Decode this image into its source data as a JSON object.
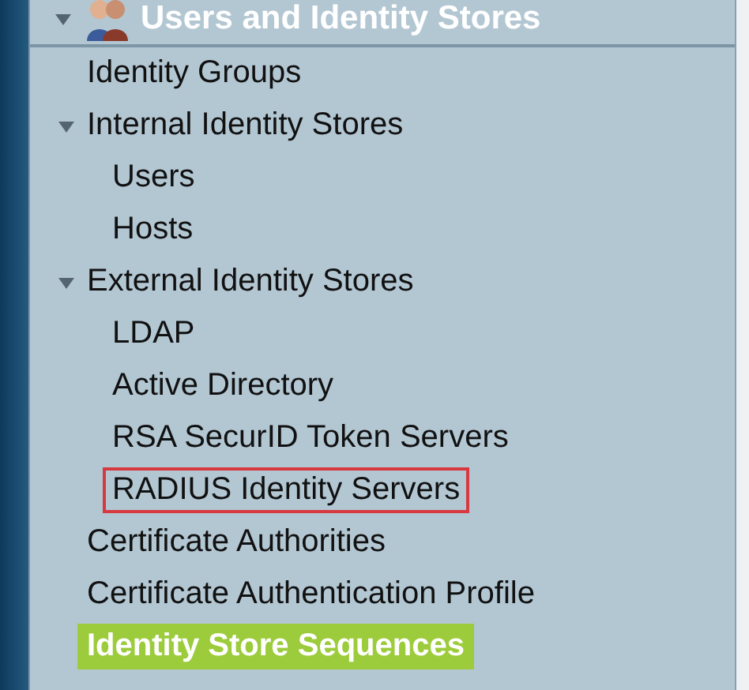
{
  "tree": {
    "title": "Users and Identity Stores",
    "expanded": true,
    "children": [
      {
        "label": "Identity Groups",
        "selected": false,
        "outlined": false
      },
      {
        "label": "Internal Identity Stores",
        "selected": false,
        "outlined": false,
        "expanded": true,
        "children": [
          {
            "label": "Users",
            "selected": false,
            "outlined": false
          },
          {
            "label": "Hosts",
            "selected": false,
            "outlined": false
          }
        ]
      },
      {
        "label": "External Identity Stores",
        "selected": false,
        "outlined": false,
        "expanded": true,
        "children": [
          {
            "label": "LDAP",
            "selected": false,
            "outlined": false
          },
          {
            "label": "Active Directory",
            "selected": false,
            "outlined": false
          },
          {
            "label": "RSA SecurID Token Servers",
            "selected": false,
            "outlined": false
          },
          {
            "label": "RADIUS Identity Servers",
            "selected": false,
            "outlined": true
          }
        ]
      },
      {
        "label": "Certificate Authorities",
        "selected": false,
        "outlined": false
      },
      {
        "label": "Certificate Authentication Profile",
        "selected": false,
        "outlined": false
      },
      {
        "label": "Identity Store Sequences",
        "selected": true,
        "outlined": false
      }
    ]
  }
}
